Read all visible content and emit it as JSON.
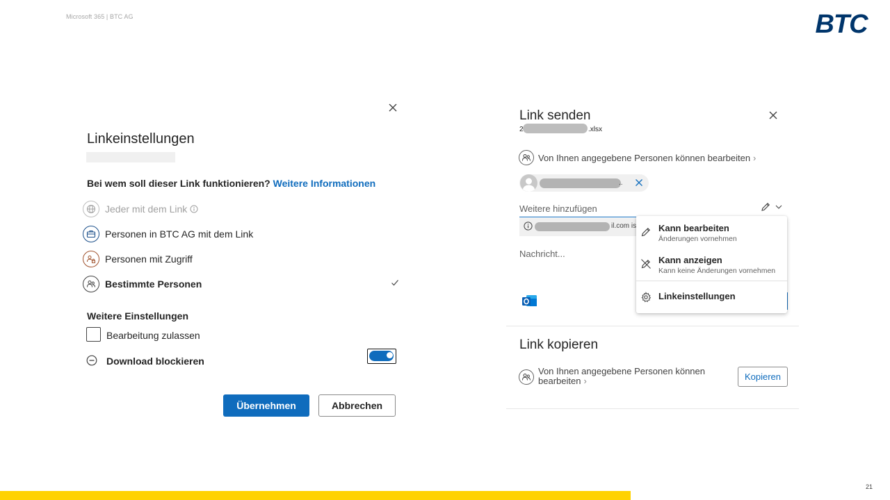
{
  "slide": {
    "header_text": "Microsoft 365 | BTC AG",
    "logo_text": "BTC",
    "page_number": "21",
    "accent_yellow": "#ffd200",
    "brand_blue": "#00356b"
  },
  "link_settings": {
    "title": "Linkeinstellungen",
    "question": "Bei wem soll dieser Link funktionieren?",
    "more_info_link": "Weitere Informationen",
    "options": [
      {
        "label": "Jeder mit dem Link",
        "icon": "globe-icon",
        "state": "disabled"
      },
      {
        "label": "Personen in BTC AG mit dem Link",
        "icon": "briefcase-icon",
        "state": "normal"
      },
      {
        "label": "Personen mit Zugriff",
        "icon": "people-lock-icon",
        "state": "normal"
      },
      {
        "label": "Bestimmte Personen",
        "icon": "people-icon",
        "state": "selected"
      }
    ],
    "more_settings_heading": "Weitere Einstellungen",
    "allow_edit_label": "Bearbeitung zulassen",
    "allow_edit_checked": false,
    "block_download_label": "Download blockieren",
    "block_download_on": true,
    "apply_button": "Übernehmen",
    "cancel_button": "Abbrechen",
    "primary_color": "#0f6cbd"
  },
  "send_link": {
    "title": "Link senden",
    "file_prefix": "2",
    "file_ext": ".xlsx",
    "permission_text": "Von Ihnen angegebene Personen können bearbeiten",
    "recipient_suffix": "..",
    "add_placeholder": "Weitere hinzufügen",
    "suggestion_suffix": "il.com is",
    "message_placeholder": "Nachricht..."
  },
  "permission_menu": {
    "items": [
      {
        "title": "Kann bearbeiten",
        "subtitle": "Änderungen vornehmen",
        "icon": "pencil-icon"
      },
      {
        "title": "Kann anzeigen",
        "subtitle": "Kann keine Änderungen vornehmen",
        "icon": "pencil-off-icon"
      },
      {
        "title": "Linkeinstellungen",
        "subtitle": "",
        "icon": "gear-icon"
      }
    ]
  },
  "copy_link": {
    "title": "Link kopieren",
    "permission_text": "Von Ihnen angegebene Personen können bearbeiten",
    "copy_button": "Kopieren"
  }
}
